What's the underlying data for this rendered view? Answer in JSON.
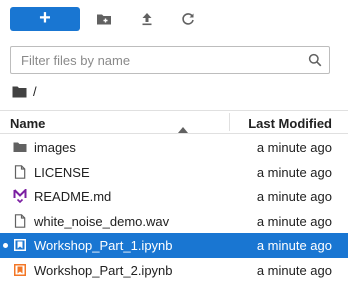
{
  "toolbar": {
    "new_label": "+"
  },
  "search": {
    "placeholder": "Filter files by name",
    "value": ""
  },
  "breadcrumb": {
    "path": "/"
  },
  "columns": {
    "name": "Name",
    "modified": "Last Modified"
  },
  "files": [
    {
      "name": "images",
      "modified": "a minute ago",
      "icon": "folder-icon",
      "selected": false,
      "running": false
    },
    {
      "name": "LICENSE",
      "modified": "a minute ago",
      "icon": "file-icon",
      "selected": false,
      "running": false
    },
    {
      "name": "README.md",
      "modified": "a minute ago",
      "icon": "markdown-icon",
      "selected": false,
      "running": false
    },
    {
      "name": "white_noise_demo.wav",
      "modified": "a minute ago",
      "icon": "file-icon",
      "selected": false,
      "running": false
    },
    {
      "name": "Workshop_Part_1.ipynb",
      "modified": "a minute ago",
      "icon": "notebook-icon",
      "selected": true,
      "running": true
    },
    {
      "name": "Workshop_Part_2.ipynb",
      "modified": "a minute ago",
      "icon": "notebook-icon",
      "selected": false,
      "running": false
    }
  ],
  "colors": {
    "accent": "#1976d2",
    "notebook": "#f37726",
    "markdown": "#7b1fa2"
  }
}
